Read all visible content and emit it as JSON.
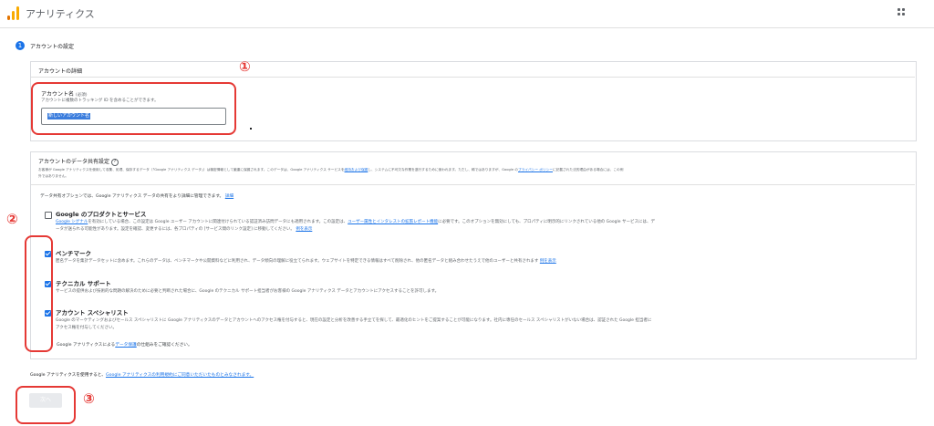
{
  "header": {
    "app_title": "アナリティクス",
    "apps_icon": "grid-icon"
  },
  "step": {
    "number": "1",
    "title": "アカウントの設定"
  },
  "account_details": {
    "card_title": "アカウントの詳細",
    "name_label": "アカウント名",
    "required": "(必須)",
    "hint": "アカウントに複数のトラッキング ID を含めることができます。",
    "input_value": "新しいアカウント名"
  },
  "sharing": {
    "title": "アカウントのデータ共有設定",
    "help_icon": "help-icon",
    "desc1": "お客様が Google アナリティクスを使用して収集、処理、保存するデータ（「Google アナリティクス データ」）は機密情報として厳重に保護されます。このデータは、Google アナリティクス サービスを",
    "desc1_link": "維持および保護",
    "desc2": "し、システムに不可欠な作業を遂行するために使われます。ただし、稀ではありますが、Google の",
    "desc2_link": "プライバシー ポリシー",
    "desc3": "に記載された法的理由がある場合には、この例",
    "desc4": "外ではありません。",
    "options_intro": "データ共有オプションでは、Google アナリティクス データの共有をより詳細に管理できます。",
    "options_intro_link": "詳細",
    "options": [
      {
        "title": "Google のプロダクトとサービス",
        "checked": false,
        "line1_link": "Google シグナル",
        "line1": "を有効にしている場合、この設定は Google ユーザー アカウントに関連付けられている認証済み訪問データにも適用されます。この設定は、",
        "line1_link2": "ユーザー属性とインタレストの拡張レポート機能",
        "line1_end": "に必要です。このオプションを無効にしても、プロパティに明示的にリンクされている他の Google サービスには、デ",
        "line2": "ータが送られる可能性があります。設定を確認、変更するには、各プロパティの [サービス間のリンク設定] に移動してください。",
        "line2_link": "例を表示"
      },
      {
        "title": "ベンチマーク",
        "checked": true,
        "line1": "匿名データを集計データセットに含めます。これらのデータは、ベンチマークや公開資料などに利用され、データ傾向の理解に役立てられます。ウェブサイトを特定できる情報はすべて削除され、他の匿名データと組み合わせたうえで他のユーザーと共有されます",
        "line1_link": "例を表示"
      },
      {
        "title": "テクニカル サポート",
        "checked": true,
        "line1": "サービスの提供および技術的な問題の解決のために必要と判断された場合に、Google のテクニカル サポート担当者がお客様の Google アナリティクス データとアカウントにアクセスすることを許可します。"
      },
      {
        "title": "アカウント スペシャリスト",
        "checked": true,
        "line1": "Google のマーケティングおよびセールス スペシャリストに Google アナリティクスのデータとアカウントへのアクセス権を付与すると、現在の設定と分析を改善する手立てを探して、最適化のヒントをご提案することが可能になります。社内に専任のセールス スペシャリストがいない場合は、認証された Google 担当者に",
        "line2": "アクセス権を付与してください。"
      }
    ],
    "footer_pre": "Google アナリティクスによる",
    "footer_link": "データ保護",
    "footer_post": "の仕組みをご確認ください。"
  },
  "terms": {
    "pre": "Google アナリティクスを使用すると、",
    "link": "Google アナリティクスの利用規約にご同意いただいたものとみなされます。"
  },
  "next_button": "次へ",
  "annotations": [
    "①",
    "②",
    "③"
  ],
  "colors": {
    "accent": "#1a73e8",
    "annotation": "#e53935",
    "logo_orange": "#f9ab00",
    "logo_dark": "#e37400"
  }
}
